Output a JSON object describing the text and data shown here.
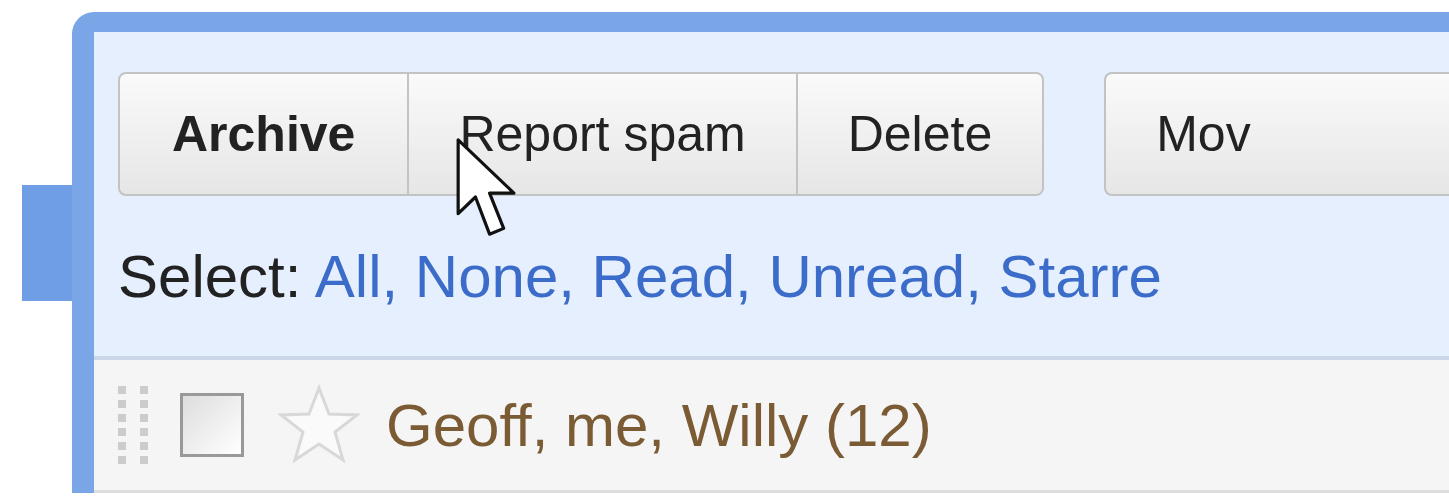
{
  "toolbar": {
    "buttons": [
      {
        "label": "Archive",
        "kind": "primary"
      },
      {
        "label": "Report spam",
        "kind": "plain"
      },
      {
        "label": "Delete",
        "kind": "plain"
      },
      {
        "label": "Mov",
        "kind": "plain"
      }
    ]
  },
  "select_bar": {
    "label": "Select:",
    "separator": ",",
    "links": [
      "All",
      "None",
      "Read",
      "Unread",
      "Starre"
    ]
  },
  "conversations": [
    {
      "senders": "Geoff, me, Willy (12)",
      "checked": false,
      "starred": false
    }
  ]
}
